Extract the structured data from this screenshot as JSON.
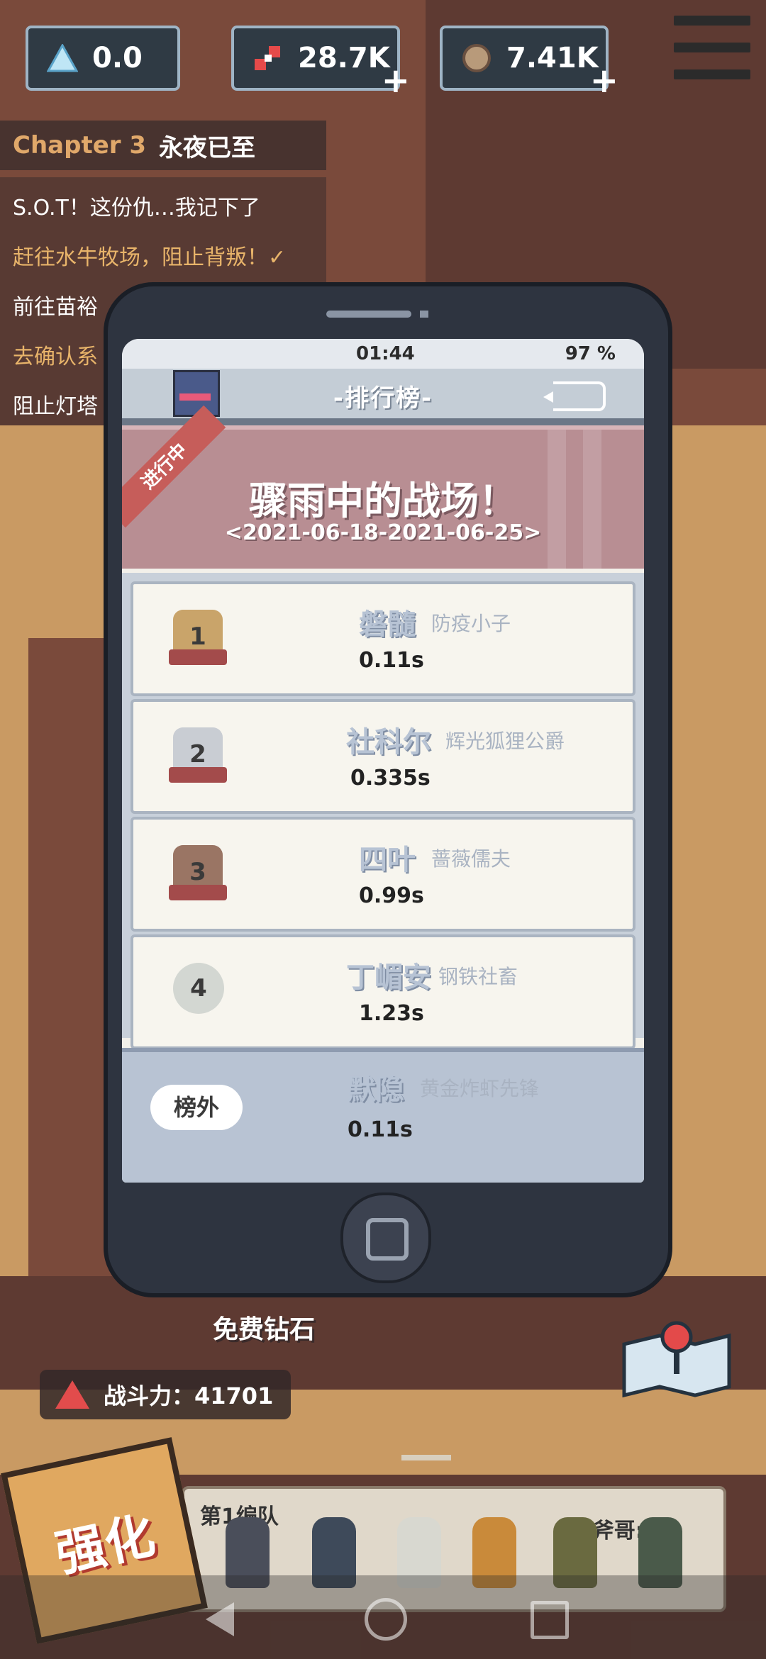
{
  "resources": [
    {
      "name": "energy",
      "icon": "triangle-crystal-icon",
      "value": "0.0"
    },
    {
      "name": "parts",
      "icon": "gear-parts-icon",
      "value": "28.7K"
    },
    {
      "name": "ore",
      "icon": "ore-rock-icon",
      "value": "7.41K"
    }
  ],
  "chapter": {
    "label": "Chapter 3",
    "title": "永夜已至"
  },
  "quests": [
    {
      "text": "S.O.T！这份仇…我记下了",
      "color": "#ffffff"
    },
    {
      "text": "赶往水牛牧场，阻止背叛！✓",
      "color": "#e8b46a"
    },
    {
      "text": "前往苗裕",
      "color": "#ffffff"
    },
    {
      "text": "去确认系",
      "color": "#e8b46a"
    },
    {
      "text": "阻止灯塔",
      "color": "#ffffff"
    }
  ],
  "phone": {
    "time": "01:44",
    "battery": "97 %",
    "header_title": "-排行榜-",
    "event": {
      "status": "进行中",
      "title": "骤雨中的战场！",
      "dates": "<2021-06-18-2021-06-25>"
    },
    "rankings": [
      {
        "rank": "1",
        "name": "磐髓",
        "title": "防疫小子",
        "score": "0.11s",
        "medal_color": "#c9a46a"
      },
      {
        "rank": "2",
        "name": "社科尔",
        "title": "辉光狐狸公爵",
        "score": "0.335s",
        "medal_color": "#c9cdd3"
      },
      {
        "rank": "3",
        "name": "四叶",
        "title": "蔷薇儒夫",
        "score": "0.99s",
        "medal_color": "#9a7564"
      },
      {
        "rank": "4",
        "name": "丁嵋安",
        "title": "钢铁社畜",
        "score": "1.23s",
        "medal_color": "#d3d7d2"
      }
    ],
    "mine": {
      "badge": "榜外",
      "name": "默隐",
      "title": "黄金炸虾先锋",
      "score": "0.11s"
    }
  },
  "hud": {
    "free_diamond": "免费钻石",
    "power_label": "战斗力：41701",
    "team_label": "第1编队",
    "leader": "斧哥: 35",
    "strengthen": "强化"
  },
  "colors": {
    "accent": "#c65d5a",
    "panel": "#2e3440"
  }
}
